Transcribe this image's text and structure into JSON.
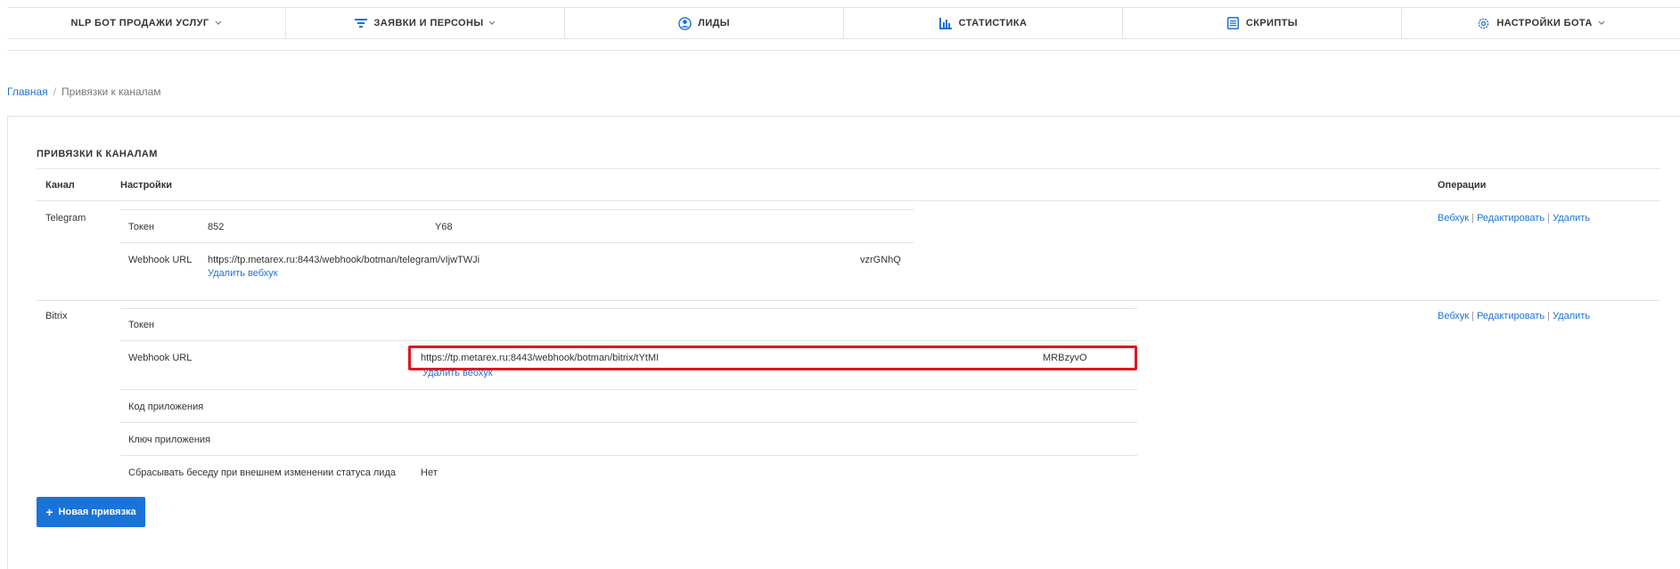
{
  "nav": {
    "items": [
      {
        "label": "NLP БОТ ПРОДАЖИ УСЛУГ",
        "icon": "",
        "dropdown": true
      },
      {
        "label": "ЗАЯВКИ И ПЕРСОНЫ",
        "icon": "filter-icon",
        "dropdown": true
      },
      {
        "label": "ЛИДЫ",
        "icon": "user-circle-icon",
        "dropdown": false
      },
      {
        "label": "СТАТИСТИКА",
        "icon": "bar-chart-icon",
        "dropdown": false
      },
      {
        "label": "СКРИПТЫ",
        "icon": "document-list-icon",
        "dropdown": false
      },
      {
        "label": "НАСТРОЙКИ БОТА",
        "icon": "gear-icon",
        "dropdown": true
      }
    ]
  },
  "breadcrumb": {
    "home": "Главная",
    "sep": "/",
    "current": "Привязки к каналам"
  },
  "card": {
    "title": "ПРИВЯЗКИ К КАНАЛАМ",
    "columns": {
      "channel": "Канал",
      "settings": "Настройки",
      "operations": "Операции"
    },
    "ops": {
      "webhook": "Вебхук",
      "edit": "Редактировать",
      "delete": "Удалить",
      "sep": "|"
    },
    "telegram": {
      "name": "Telegram",
      "token_label": "Токен",
      "token_value_start": "852",
      "token_value_end": "Y68",
      "webhook_label": "Webhook URL",
      "webhook_value_start": "https://tp.metarex.ru:8443/webhook/botman/telegram/vIjwTWJi",
      "webhook_value_end": "vzrGNhQ",
      "delete_webhook": "Удалить вебхук"
    },
    "bitrix": {
      "name": "Bitrix",
      "token_label": "Токен",
      "webhook_label": "Webhook URL",
      "webhook_value_start": "https://tp.metarex.ru:8443/webhook/botman/bitrix/tYtMI",
      "webhook_value_end": "MRBzyvO",
      "delete_webhook": "Удалить вебхук",
      "app_code_label": "Код приложения",
      "app_key_label": "Ключ приложения",
      "reset_label": "Сбрасывать беседу при внешнем изменении статуса лида",
      "reset_value": "Нет"
    },
    "new_button": "Новая привязка"
  },
  "colors": {
    "accent": "#1a73d9",
    "highlight": "#e4151d",
    "border": "#e3e3e3"
  }
}
